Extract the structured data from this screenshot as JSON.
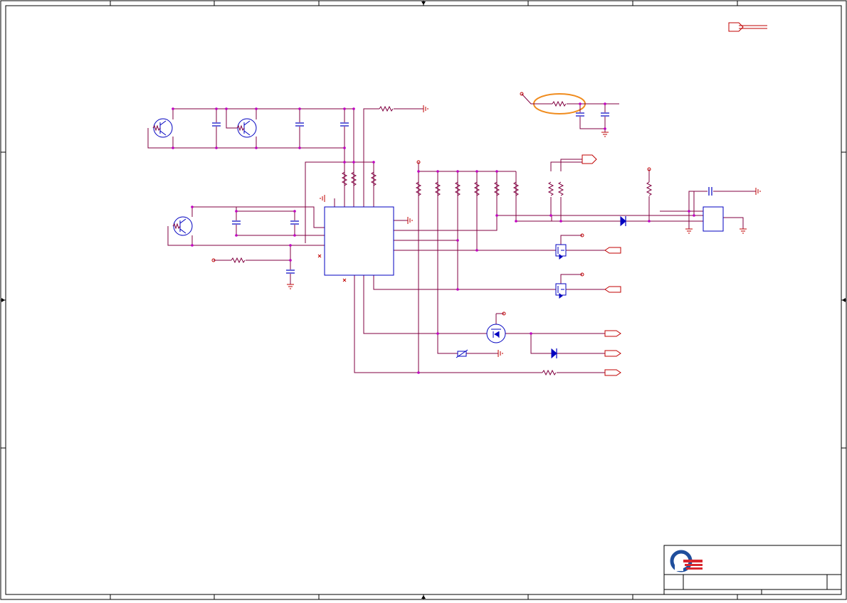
{
  "sheet": {
    "title": "",
    "frame_color": "#000000",
    "wire_color": "#800040",
    "junction_color": "#c000c0",
    "component_color": "#0000c0",
    "power_color": "#c00000",
    "highlight_color": "#f08c1e",
    "logo_blue": "#1f4e9c",
    "logo_red": "#d9262e"
  },
  "components": {
    "transistor_icon": "npn-transistor-icon",
    "mosfet_icon": "mosfet-icon",
    "diode_icon": "diode-icon",
    "resistor_icon": "resistor-icon",
    "capacitor_icon": "capacitor-icon",
    "ground_icon": "ground-icon",
    "ic_icon": "ic-block-icon",
    "off_page_connector_icon": "off-page-connector-icon"
  }
}
